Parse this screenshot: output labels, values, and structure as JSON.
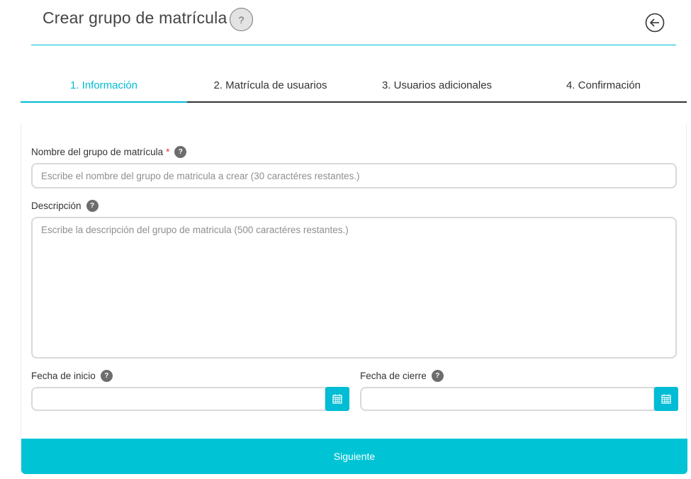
{
  "header": {
    "title": "Crear grupo de matrícula",
    "help_symbol": "?"
  },
  "tabs": [
    {
      "label": "1. Información",
      "active": true
    },
    {
      "label": "2. Matrícula de usuarios",
      "active": false
    },
    {
      "label": "3. Usuarios adicionales",
      "active": false
    },
    {
      "label": "4. Confirmación",
      "active": false
    }
  ],
  "form": {
    "name": {
      "label": "Nombre del grupo de matrícula",
      "required_mark": "*",
      "help_symbol": "?",
      "value": "",
      "placeholder": "Escribe el nombre del grupo de matricula a crear (30 caractéres restantes.)"
    },
    "description": {
      "label": "Descripción",
      "help_symbol": "?",
      "value": "",
      "placeholder": "Escribe la descripción del grupo de matricula (500 caractéres restantes.)"
    },
    "start_date": {
      "label": "Fecha de inicio",
      "help_symbol": "?",
      "value": ""
    },
    "end_date": {
      "label": "Fecha de cierre",
      "help_symbol": "?",
      "value": ""
    }
  },
  "actions": {
    "next_label": "Siguiente"
  },
  "colors": {
    "accent": "#00bcd4",
    "required": "#e53935",
    "help_dot": "#6d6d6d"
  },
  "icons": {
    "back": "back-arrow-icon",
    "calendar": "calendar-icon",
    "help": "help-icon"
  }
}
